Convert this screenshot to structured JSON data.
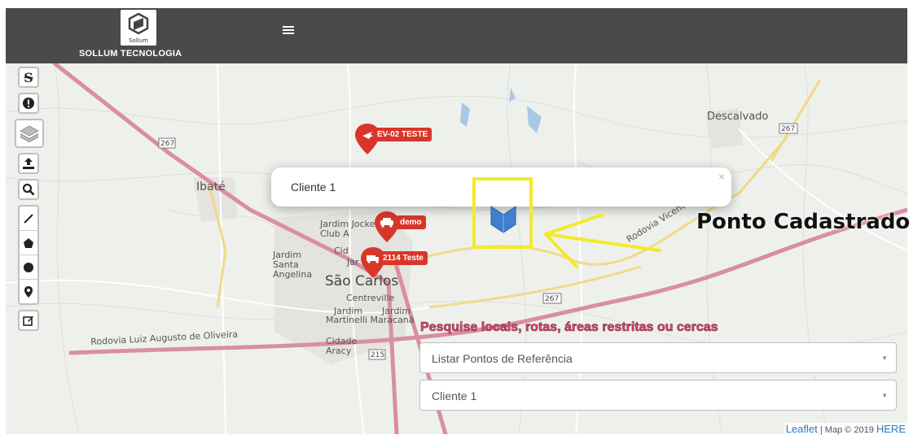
{
  "header": {
    "logo_caption": "Sollum",
    "brand": "SOLLUM TECNOLOGIA",
    "menu_icon": "hamburger-icon"
  },
  "toolbar": {
    "tools": [
      "strike-icon",
      "info-icon",
      "layers-icon",
      "upload-icon",
      "search-icon",
      "line-draw-icon",
      "polygon-icon",
      "circle-icon",
      "marker-icon",
      "edit-icon"
    ]
  },
  "map": {
    "places": [
      "Ibaté",
      "Descalvado",
      "Jardim Jockei Club A",
      "Cid",
      "Jardim Santa Angelina",
      "Jar",
      "São Carlos",
      "Centreville",
      "Jardim",
      "Jardim",
      "Martinelli Maracanã",
      "Cidade Aracy"
    ],
    "roads": [
      "Rodovia Luiz Augusto de Oliveira",
      "Rodovia Vicente Botta"
    ],
    "shields": [
      "267",
      "267",
      "267",
      "215"
    ]
  },
  "markers": [
    {
      "label": "EV-02 TESTE",
      "icon": "plane-icon"
    },
    {
      "label": "demo",
      "icon": "car-icon"
    },
    {
      "label": "2114 Teste",
      "icon": "truck-icon"
    }
  ],
  "popup": {
    "text": "Cliente 1",
    "close": "×"
  },
  "annotation": "Ponto Cadastrado",
  "search": {
    "title": "Pesquise locais, rotas, áreas restritas ou cercas",
    "select1": "Listar Pontos de Referência",
    "select2": "Cliente 1"
  },
  "attribution": {
    "leaflet": "Leaflet",
    "sep": "| Map © 2019",
    "here": "HERE"
  },
  "colors": {
    "header": "#4a4a4a",
    "marker": "#d9362b",
    "highlight": "#f2ea2a",
    "road": "#d98fa0"
  }
}
